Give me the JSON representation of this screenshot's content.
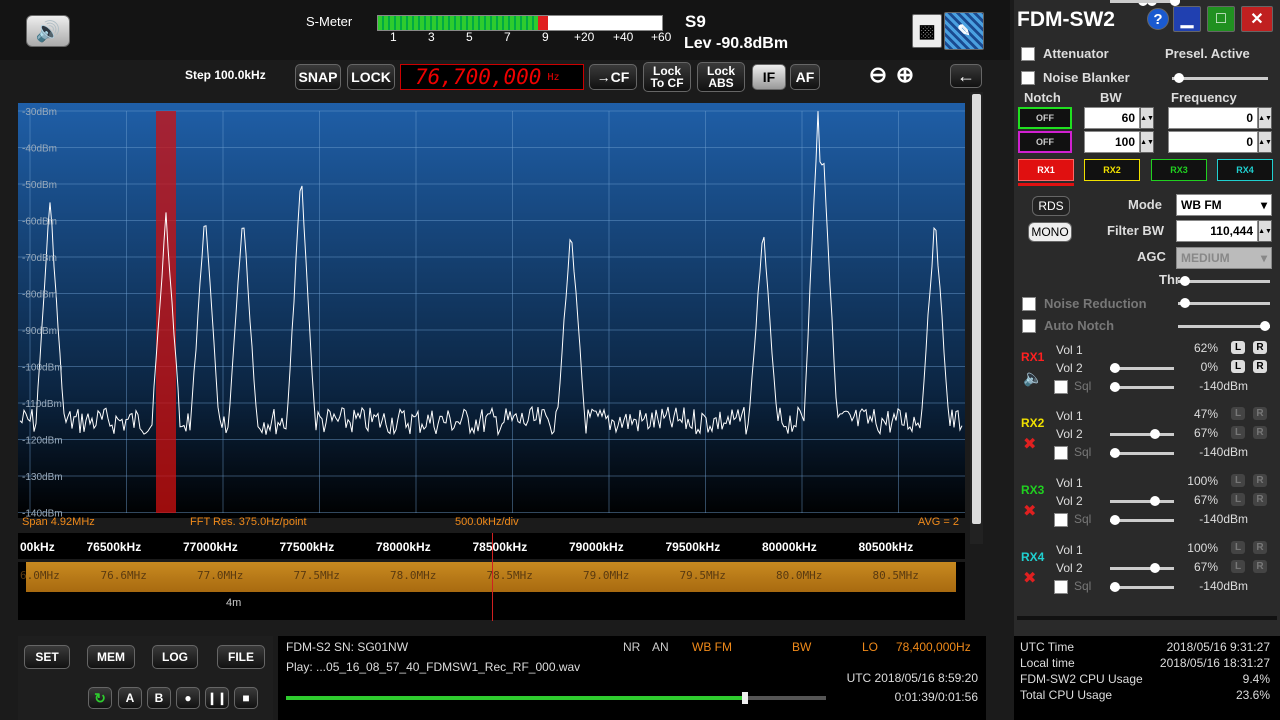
{
  "top": {
    "smeter_label": "S-Meter",
    "smeter_scale": [
      "1",
      "3",
      "5",
      "7",
      "9",
      "+20",
      "+40",
      "+60"
    ],
    "smeter_level": 0.6,
    "s_value": "S9",
    "level": "Lev -90.8dBm"
  },
  "toolbar": {
    "step_label": "Step 100.0kHz",
    "snap_label": "SNAP",
    "lock_label": "LOCK",
    "frequency": "76,700,000",
    "frequency_unit": "Hz",
    "to_cf_label": "→CF",
    "lock_to_cf_label": "Lock\nTo CF",
    "lock_abs_label": "Lock\nABS",
    "if_label": "IF",
    "af_label": "AF"
  },
  "spectrum": {
    "db_labels": [
      "-30dBm",
      "-40dBm",
      "-50dBm",
      "-60dBm",
      "-70dBm",
      "-80dBm",
      "-90dBm",
      "-100dBm",
      "-110dBm",
      "-120dBm",
      "-130dBm",
      "-140dBm"
    ],
    "span": "Span 4.92MHz",
    "fft_res": "FFT Res. 375.0Hz/point",
    "div": "500.0kHz/div",
    "avg": "AVG = 2",
    "axis_labels": [
      "00kHz",
      "76500kHz",
      "77000kHz",
      "77500kHz",
      "78000kHz",
      "78500kHz",
      "79000kHz",
      "79500kHz",
      "80000kHz",
      "80500kHz"
    ],
    "waterfall_labels": [
      "6.0MHz",
      "76.6MHz",
      "77.0MHz",
      "77.5MHz",
      "78.0MHz",
      "78.5MHz",
      "79.0MHz",
      "79.5MHz",
      "80.0MHz",
      "80.5MHz"
    ],
    "time_label": "4m"
  },
  "bottom": {
    "set_label": "SET",
    "mem_label": "MEM",
    "log_label": "LOG",
    "file_label": "FILE",
    "a_label": "A",
    "b_label": "B",
    "device": "FDM-S2 SN: SG01NW",
    "nr": "NR",
    "an": "AN",
    "mode": "WB FM",
    "bw": "BW",
    "lo": "LO",
    "lo_value": "78,400,000Hz",
    "play": "Play: ...05_16_08_57_40_FDMSW1_Rec_RF_000.wav",
    "utc": "UTC 2018/05/16 8:59:20",
    "elapsed": "0:01:39/0:01:56",
    "progress": 0.85
  },
  "right": {
    "title": "FDM-SW2",
    "attenuator": "Attenuator",
    "presel": "Presel. Active",
    "noise_blanker": "Noise Blanker",
    "notch": "Notch",
    "bw": "BW",
    "frequency": "Frequency",
    "notch1_state": "OFF",
    "notch1_bw": "60",
    "notch1_freq": "0",
    "notch2_state": "OFF",
    "notch2_bw": "100",
    "notch2_freq": "0",
    "rx_tabs": [
      "RX1",
      "RX2",
      "RX3",
      "RX4"
    ],
    "rds": "RDS",
    "mono": "MONO",
    "mode_label": "Mode",
    "mode_value": "WB FM",
    "filter_bw_label": "Filter BW",
    "filter_bw_value": "110,444",
    "agc_label": "AGC",
    "agc_value": "MEDIUM",
    "thr_label": "Thr",
    "noise_reduction": "Noise Reduction",
    "auto_notch": "Auto Notch",
    "rx": [
      {
        "name": "RX1",
        "color": "#ff2020",
        "vol1": "62%",
        "vol2": "0%",
        "sql": "-140dBm"
      },
      {
        "name": "RX2",
        "color": "#f0e000",
        "vol1": "47%",
        "vol2": "67%",
        "sql": "-140dBm"
      },
      {
        "name": "RX3",
        "color": "#20d020",
        "vol1": "100%",
        "vol2": "67%",
        "sql": "-140dBm"
      },
      {
        "name": "RX4",
        "color": "#20d0d0",
        "vol1": "100%",
        "vol2": "67%",
        "sql": "-140dBm"
      }
    ],
    "rx_levels": [
      {
        "vol1": 0.62,
        "vol2": 0.0
      },
      {
        "vol1": 0.47,
        "vol2": 0.67
      },
      {
        "vol1": 1.0,
        "vol2": 0.67
      },
      {
        "vol1": 1.0,
        "vol2": 0.67
      }
    ],
    "vol1_label": "Vol 1",
    "vol2_label": "Vol 2",
    "sql_label": "Sql",
    "status": {
      "utc_label": "UTC Time",
      "utc_value": "2018/05/16 9:31:27",
      "local_label": "Local time",
      "local_value": "2018/05/16 18:31:27",
      "cpu_label": "FDM-SW2 CPU Usage",
      "cpu_value": "9.4%",
      "total_label": "Total CPU Usage",
      "total_value": "23.6%"
    }
  }
}
